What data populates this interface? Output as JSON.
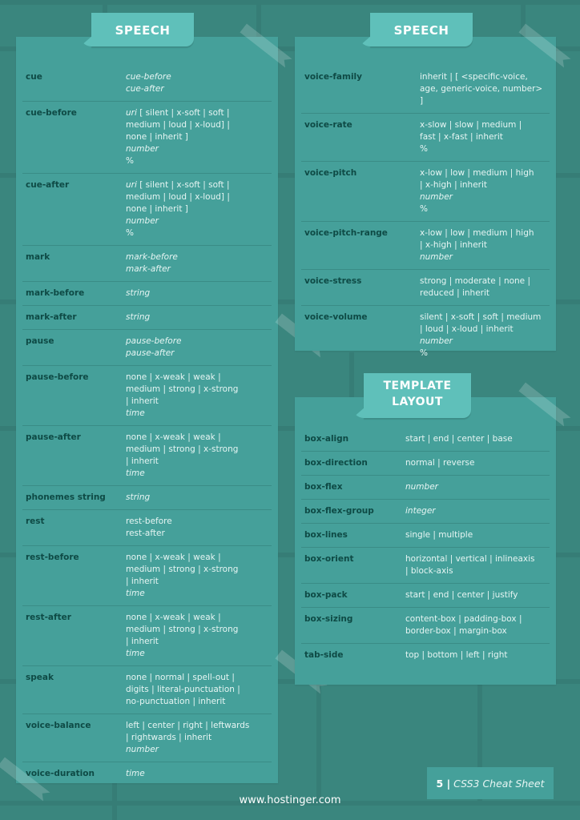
{
  "colors": {
    "background": "#3a867e",
    "card": "#45a09a",
    "tab": "#5fc0ba",
    "property_text": "#0e4a45",
    "value_text": "#e6f5f3"
  },
  "sections": {
    "left": {
      "title": "SPEECH",
      "rows": [
        {
          "prop": "cue",
          "lines": [
            {
              "t": "cue-before",
              "i": true
            },
            {
              "t": "cue-after",
              "i": true
            }
          ]
        },
        {
          "prop": "cue-before",
          "lines": [
            {
              "t": "uri [ silent | x-soft | soft |",
              "i": false,
              "lead_italic": "uri"
            },
            {
              "t": "medium | loud | x-loud] |",
              "i": false
            },
            {
              "t": "none | inherit ]",
              "i": false
            },
            {
              "t": "number",
              "i": true
            },
            {
              "t": "%",
              "i": false
            }
          ]
        },
        {
          "prop": "cue-after",
          "lines": [
            {
              "t": "uri [ silent | x-soft | soft |",
              "i": false,
              "lead_italic": "uri"
            },
            {
              "t": "medium | loud | x-loud] |",
              "i": false
            },
            {
              "t": "none | inherit ]",
              "i": false
            },
            {
              "t": "number",
              "i": true
            },
            {
              "t": "%",
              "i": false
            }
          ]
        },
        {
          "prop": "mark",
          "lines": [
            {
              "t": "mark-before",
              "i": true
            },
            {
              "t": "mark-after",
              "i": true
            }
          ]
        },
        {
          "prop": "mark-before",
          "lines": [
            {
              "t": "string",
              "i": true
            }
          ]
        },
        {
          "prop": "mark-after",
          "lines": [
            {
              "t": "string",
              "i": true
            }
          ]
        },
        {
          "prop": "pause",
          "lines": [
            {
              "t": "pause-before",
              "i": true
            },
            {
              "t": "pause-after",
              "i": true
            }
          ]
        },
        {
          "prop": "pause-before",
          "lines": [
            {
              "t": "none | x-weak | weak |",
              "i": false
            },
            {
              "t": "medium | strong | x-strong",
              "i": false
            },
            {
              "t": "| inherit",
              "i": false
            },
            {
              "t": "time",
              "i": true
            }
          ]
        },
        {
          "prop": "pause-after",
          "lines": [
            {
              "t": "none | x-weak | weak |",
              "i": false
            },
            {
              "t": "medium | strong | x-strong",
              "i": false
            },
            {
              "t": "| inherit",
              "i": false
            },
            {
              "t": "time",
              "i": true
            }
          ]
        },
        {
          "prop": "phonemes string",
          "lines": [
            {
              "t": "string",
              "i": true
            }
          ]
        },
        {
          "prop": "rest",
          "lines": [
            {
              "t": "rest-before",
              "i": false
            },
            {
              "t": "rest-after",
              "i": false
            }
          ]
        },
        {
          "prop": "rest-before",
          "lines": [
            {
              "t": "none | x-weak | weak |",
              "i": false
            },
            {
              "t": "medium | strong | x-strong",
              "i": false
            },
            {
              "t": "| inherit",
              "i": false
            },
            {
              "t": "time",
              "i": true
            }
          ]
        },
        {
          "prop": "rest-after",
          "lines": [
            {
              "t": "none | x-weak | weak |",
              "i": false
            },
            {
              "t": "medium | strong | x-strong",
              "i": false
            },
            {
              "t": "| inherit",
              "i": false
            },
            {
              "t": "time",
              "i": true
            }
          ]
        },
        {
          "prop": "speak",
          "lines": [
            {
              "t": "none | normal | spell-out |",
              "i": false
            },
            {
              "t": "digits | literal-punctuation |",
              "i": false
            },
            {
              "t": "no-punctuation | inherit",
              "i": false
            }
          ]
        },
        {
          "prop": "voice-balance",
          "lines": [
            {
              "t": "left | center | right | leftwards",
              "i": false
            },
            {
              "t": "| rightwards | inherit",
              "i": false
            },
            {
              "t": "number",
              "i": true
            }
          ]
        },
        {
          "prop": "voice-duration",
          "lines": [
            {
              "t": "time",
              "i": true
            }
          ]
        }
      ]
    },
    "right_top": {
      "title": "SPEECH",
      "rows": [
        {
          "prop": "voice-family",
          "lines": [
            {
              "t": "inherit | [ <specific-voice,",
              "i": false
            },
            {
              "t": "age, generic-voice, number> ]",
              "i": false
            }
          ]
        },
        {
          "prop": "voice-rate",
          "lines": [
            {
              "t": "x-slow | slow | medium |",
              "i": false
            },
            {
              "t": "fast | x-fast | inherit",
              "i": false
            },
            {
              "t": "%",
              "i": false
            }
          ]
        },
        {
          "prop": "voice-pitch",
          "lines": [
            {
              "t": "x-low | low | medium | high",
              "i": false
            },
            {
              "t": "| x-high | inherit",
              "i": false
            },
            {
              "t": "number",
              "i": true
            },
            {
              "t": "%",
              "i": false
            }
          ]
        },
        {
          "prop": "voice-pitch-range",
          "lines": [
            {
              "t": "x-low | low | medium | high",
              "i": false
            },
            {
              "t": "| x-high | inherit",
              "i": false
            },
            {
              "t": "number",
              "i": true
            }
          ]
        },
        {
          "prop": "voice-stress",
          "lines": [
            {
              "t": "strong | moderate | none |",
              "i": false
            },
            {
              "t": "reduced | inherit",
              "i": false
            }
          ]
        },
        {
          "prop": "voice-volume",
          "lines": [
            {
              "t": "silent | x-soft | soft | medium",
              "i": false
            },
            {
              "t": "| loud | x-loud | inherit",
              "i": false
            },
            {
              "t": "number",
              "i": true
            },
            {
              "t": "%",
              "i": false
            }
          ]
        }
      ]
    },
    "right_bottom": {
      "title_line1": "TEMPLATE",
      "title_line2": "LAYOUT",
      "rows": [
        {
          "prop": "box-align",
          "lines": [
            {
              "t": "start | end | center | base",
              "i": false
            }
          ]
        },
        {
          "prop": "box-direction",
          "lines": [
            {
              "t": "normal | reverse",
              "i": false
            }
          ]
        },
        {
          "prop": "box-flex",
          "lines": [
            {
              "t": "number",
              "i": true
            }
          ]
        },
        {
          "prop": "box-flex-group",
          "lines": [
            {
              "t": "integer",
              "i": true
            }
          ]
        },
        {
          "prop": "box-lines",
          "lines": [
            {
              "t": "single | multiple",
              "i": false
            }
          ]
        },
        {
          "prop": "box-orient",
          "lines": [
            {
              "t": "horizontal | vertical | inlineaxis",
              "i": false
            },
            {
              "t": "| block-axis",
              "i": false
            }
          ]
        },
        {
          "prop": "box-pack",
          "lines": [
            {
              "t": "start | end | center | justify",
              "i": false
            }
          ]
        },
        {
          "prop": "box-sizing",
          "lines": [
            {
              "t": "content-box | padding-box |",
              "i": false
            },
            {
              "t": "border-box | margin-box",
              "i": false
            }
          ]
        },
        {
          "prop": "tab-side",
          "lines": [
            {
              "t": "top | bottom | left | right",
              "i": false
            }
          ]
        }
      ]
    }
  },
  "footer": {
    "url": "www.hostinger.com",
    "page_number": "5 |",
    "doc_title": "CSS3 Cheat Sheet"
  }
}
